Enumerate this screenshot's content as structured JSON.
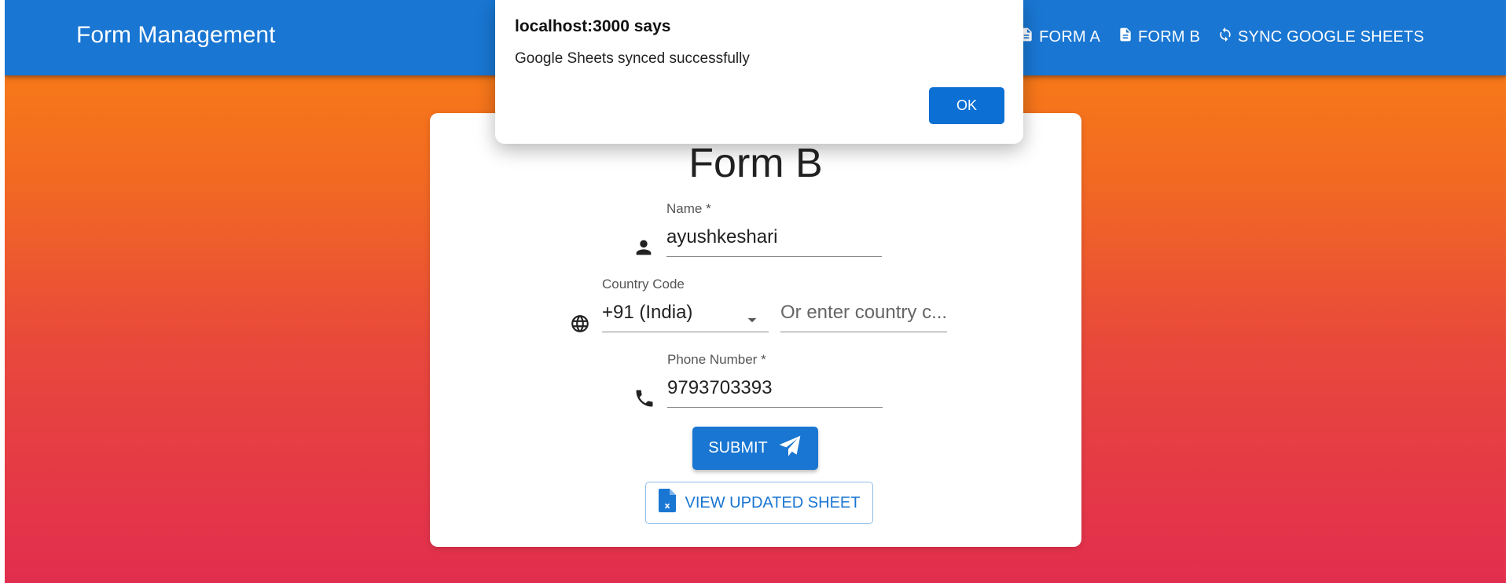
{
  "app": {
    "title": "Form Management"
  },
  "nav": {
    "items": [
      {
        "label": "FORM A",
        "icon": "file-icon"
      },
      {
        "label": "FORM B",
        "icon": "file-icon"
      },
      {
        "label": "SYNC GOOGLE SHEETS",
        "icon": "sync-icon"
      }
    ]
  },
  "form": {
    "title": "Form B",
    "name": {
      "label": "Name *",
      "value": "ayushkeshari",
      "icon": "person-icon"
    },
    "country": {
      "label": "Country Code",
      "selected": "+91 (India)",
      "manual_placeholder": "Or enter country c...",
      "icon": "globe-icon"
    },
    "phone": {
      "label": "Phone Number *",
      "value": "9793703393",
      "icon": "phone-icon"
    },
    "submit_label": "SUBMIT",
    "view_sheet_label": "VIEW UPDATED SHEET"
  },
  "dialog": {
    "title": "localhost:3000 says",
    "message": "Google Sheets synced successfully",
    "ok_label": "OK"
  },
  "colors": {
    "appbar": "#1976d2",
    "gradient_top": "#fb8311",
    "gradient_bottom": "#e22e4e",
    "dialog_button": "#0b6fd4"
  }
}
